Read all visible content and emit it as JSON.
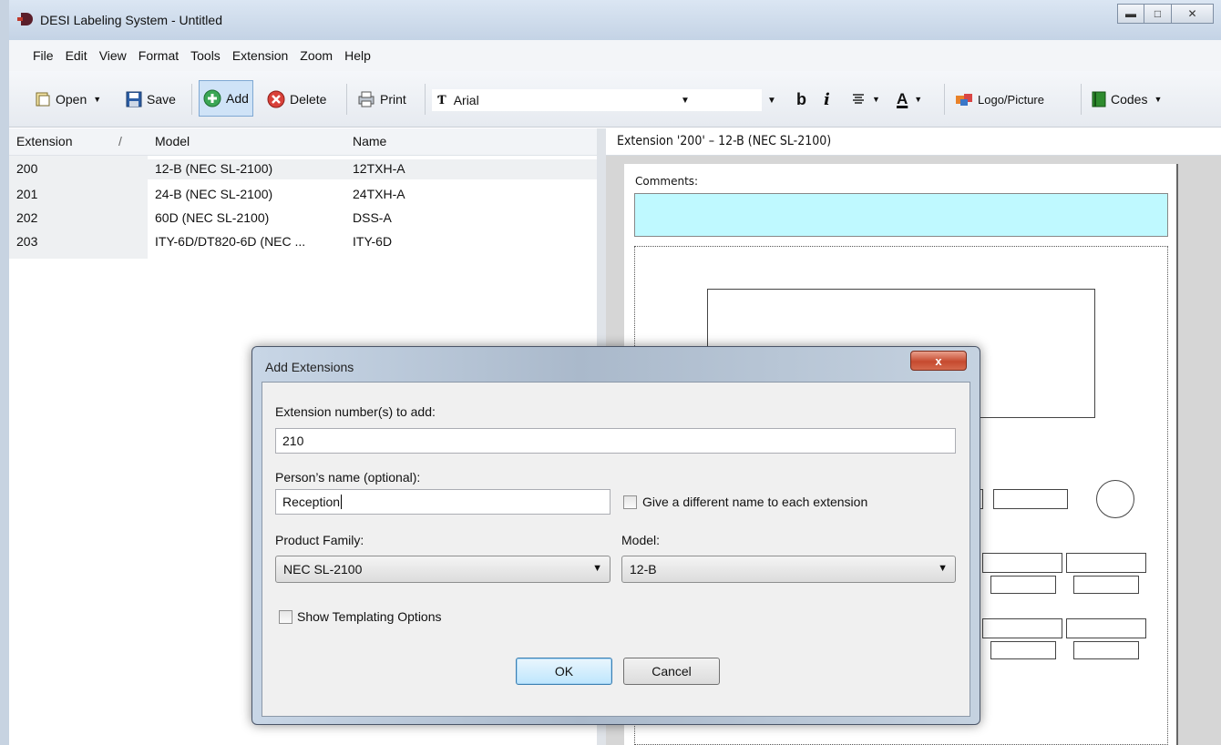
{
  "window": {
    "title": "DESI Labeling System - Untitled",
    "controls": [
      "minimize-icon",
      "maximize-icon",
      "close-icon"
    ]
  },
  "menu": [
    "File",
    "Edit",
    "View",
    "Format",
    "Tools",
    "Extension",
    "Zoom",
    "Help"
  ],
  "toolbar": {
    "open": "Open",
    "save": "Save",
    "add": "Add",
    "delete": "Delete",
    "print": "Print",
    "font": "Arial",
    "bold": "b",
    "italic": "i",
    "font_color": "A",
    "logo": "Logo/Picture",
    "codes": "Codes"
  },
  "list": {
    "headers": [
      "Extension",
      "Model",
      "Name"
    ],
    "sort_indicator": "/",
    "rows": [
      {
        "ext": "200",
        "model": "12-B (NEC SL-2100)",
        "name": "12TXH-A"
      },
      {
        "ext": "201",
        "model": "24-B (NEC SL-2100)",
        "name": "24TXH-A"
      },
      {
        "ext": "202",
        "model": "60D (NEC SL-2100)",
        "name": "DSS-A"
      },
      {
        "ext": "203",
        "model": "ITY-6D/DT820-6D (NEC ...",
        "name": "ITY-6D"
      }
    ]
  },
  "preview": {
    "header": "Extension '200' – 12-B (NEC SL-2100)",
    "comments_label": "Comments:"
  },
  "dialog": {
    "title": "Add Extensions",
    "close": "x",
    "ext_label": "Extension number(s) to add:",
    "ext_value": "210",
    "name_label": "Person’s name (optional):",
    "name_value": "Reception",
    "diff_name_label": "Give a different name to each extension",
    "family_label": "Product Family:",
    "family_value": "NEC SL-2100",
    "model_label": "Model:",
    "model_value": "12-B",
    "templating_label": "Show Templating Options",
    "ok": "OK",
    "cancel": "Cancel"
  },
  "colors": {
    "comments_fill": "#bff9ff",
    "close_button": "#c64a2f",
    "titlebar": "#c4d3e5"
  }
}
